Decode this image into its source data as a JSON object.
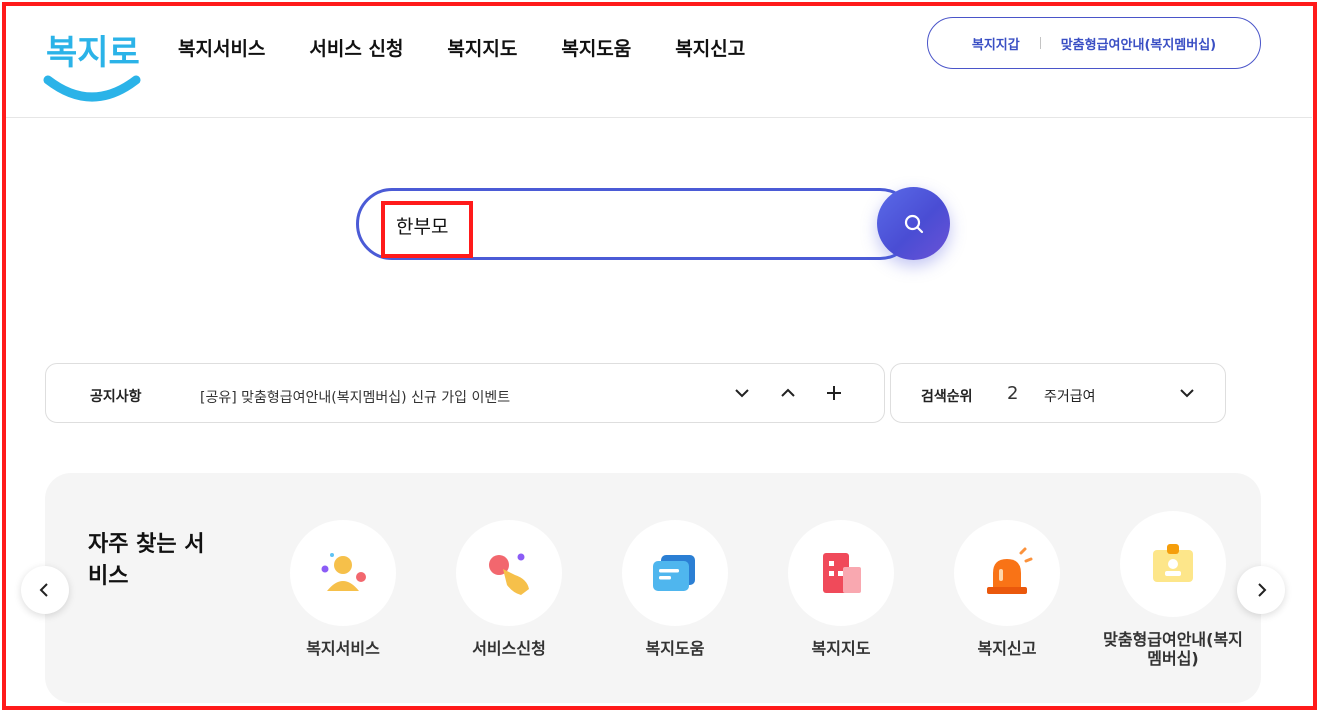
{
  "header": {
    "logo_text": "복지로",
    "nav": [
      "복지서비스",
      "서비스 신청",
      "복지지도",
      "복지도움",
      "복지신고"
    ],
    "pill": {
      "wallet": "복지지갑",
      "membership": "맞춤형급여안내(복지멤버십)"
    }
  },
  "search": {
    "value": "한부모"
  },
  "notice": {
    "label": "공지사항",
    "text": "[공유] 맞춤형급여안내(복지멤버십) 신규 가입 이벤트"
  },
  "rank": {
    "label": "검색순위",
    "number": "2",
    "term": "주거급여"
  },
  "frequent": {
    "title": "자주 찾는 서비스",
    "items": [
      "복지서비스",
      "서비스신청",
      "복지도움",
      "복지지도",
      "복지신고",
      "맞춤형급여안내(복지멤버십)"
    ]
  },
  "colors": {
    "accent": "#4b5bd6",
    "highlight": "#ff1a1a",
    "logo_blue": "#2bb3e8"
  }
}
